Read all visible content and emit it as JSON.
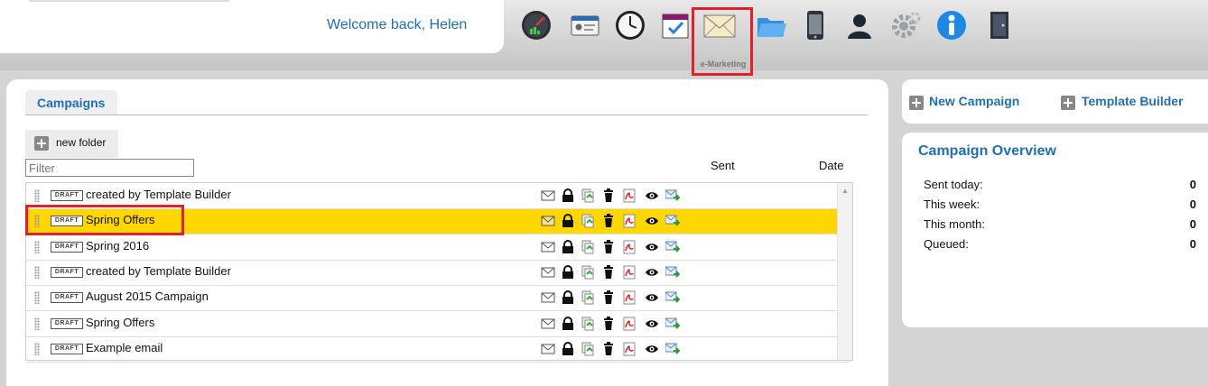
{
  "header": {
    "welcome": "Welcome back, Helen",
    "nav_icons": [
      "dashboard-gauge-icon",
      "contact-card-icon",
      "clock-icon",
      "calendar-check-icon",
      "envelope-icon",
      "folder-icon",
      "mobile-phone-icon",
      "user-silhouette-icon",
      "settings-gear-icon",
      "info-person-icon",
      "door-exit-icon"
    ],
    "active_label": "e-Marketing"
  },
  "campaigns": {
    "tab_label": "Campaigns",
    "new_folder_label": "new folder",
    "filter_placeholder": "Filter",
    "columns": {
      "sent": "Sent",
      "date": "Date"
    },
    "draft_badge": "DRAFT",
    "rows": [
      {
        "name": "created by Template Builder",
        "selected": false
      },
      {
        "name": "Spring Offers",
        "selected": true
      },
      {
        "name": "Spring 2016",
        "selected": false
      },
      {
        "name": "created by Template Builder",
        "selected": false
      },
      {
        "name": "August 2015 Campaign",
        "selected": false
      },
      {
        "name": "Spring Offers",
        "selected": false
      },
      {
        "name": "Example email",
        "selected": false
      }
    ],
    "row_action_icons": [
      "envelope-icon",
      "lock-icon",
      "copy-icon",
      "trash-icon",
      "pdf-icon",
      "eye-icon",
      "send-icon"
    ]
  },
  "actions": {
    "new_campaign": "New Campaign",
    "template_builder": "Template Builder"
  },
  "overview": {
    "title": "Campaign Overview",
    "stats": [
      {
        "label": "Sent today:",
        "value": "0"
      },
      {
        "label": "This week:",
        "value": "0"
      },
      {
        "label": "This month:",
        "value": "0"
      },
      {
        "label": "Queued:",
        "value": "0"
      }
    ]
  },
  "colors": {
    "accent": "#1f6fb5",
    "selected_row": "#ffd700",
    "highlight": "#e0202a"
  }
}
